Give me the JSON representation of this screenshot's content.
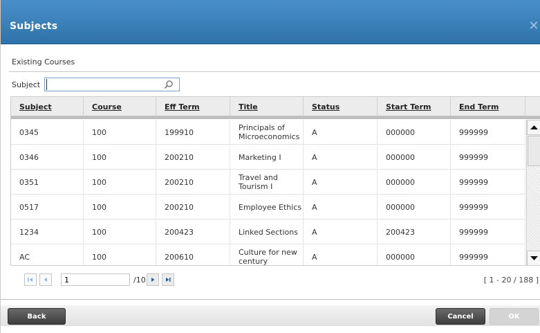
{
  "dialog": {
    "title": "Subjects"
  },
  "section": {
    "label": "Existing Courses"
  },
  "filter": {
    "label": "Subject",
    "value": ""
  },
  "table": {
    "columns": [
      "Subject",
      "Course",
      "Eff Term",
      "Title",
      "Status",
      "Start Term",
      "End Term"
    ],
    "rows": [
      [
        "0345",
        "100",
        "199910",
        "Principals of Microeconomics",
        "A",
        "000000",
        "999999"
      ],
      [
        "0346",
        "100",
        "200210",
        "Marketing I",
        "A",
        "000000",
        "999999"
      ],
      [
        "0351",
        "100",
        "200210",
        "Travel and Tourism I",
        "A",
        "000000",
        "999999"
      ],
      [
        "0517",
        "100",
        "200210",
        "Employee Ethics",
        "A",
        "000000",
        "999999"
      ],
      [
        "1234",
        "100",
        "200423",
        "Linked Sections",
        "A",
        "200423",
        "999999"
      ],
      [
        "AC",
        "100",
        "200610",
        "Culture for new century",
        "A",
        "000000",
        "999999"
      ]
    ]
  },
  "pager": {
    "page": "1",
    "total": "/10",
    "range": "[ 1 - 20 / 188 ]"
  },
  "footer": {
    "back": "Back",
    "cancel": "Cancel",
    "ok": "OK"
  }
}
